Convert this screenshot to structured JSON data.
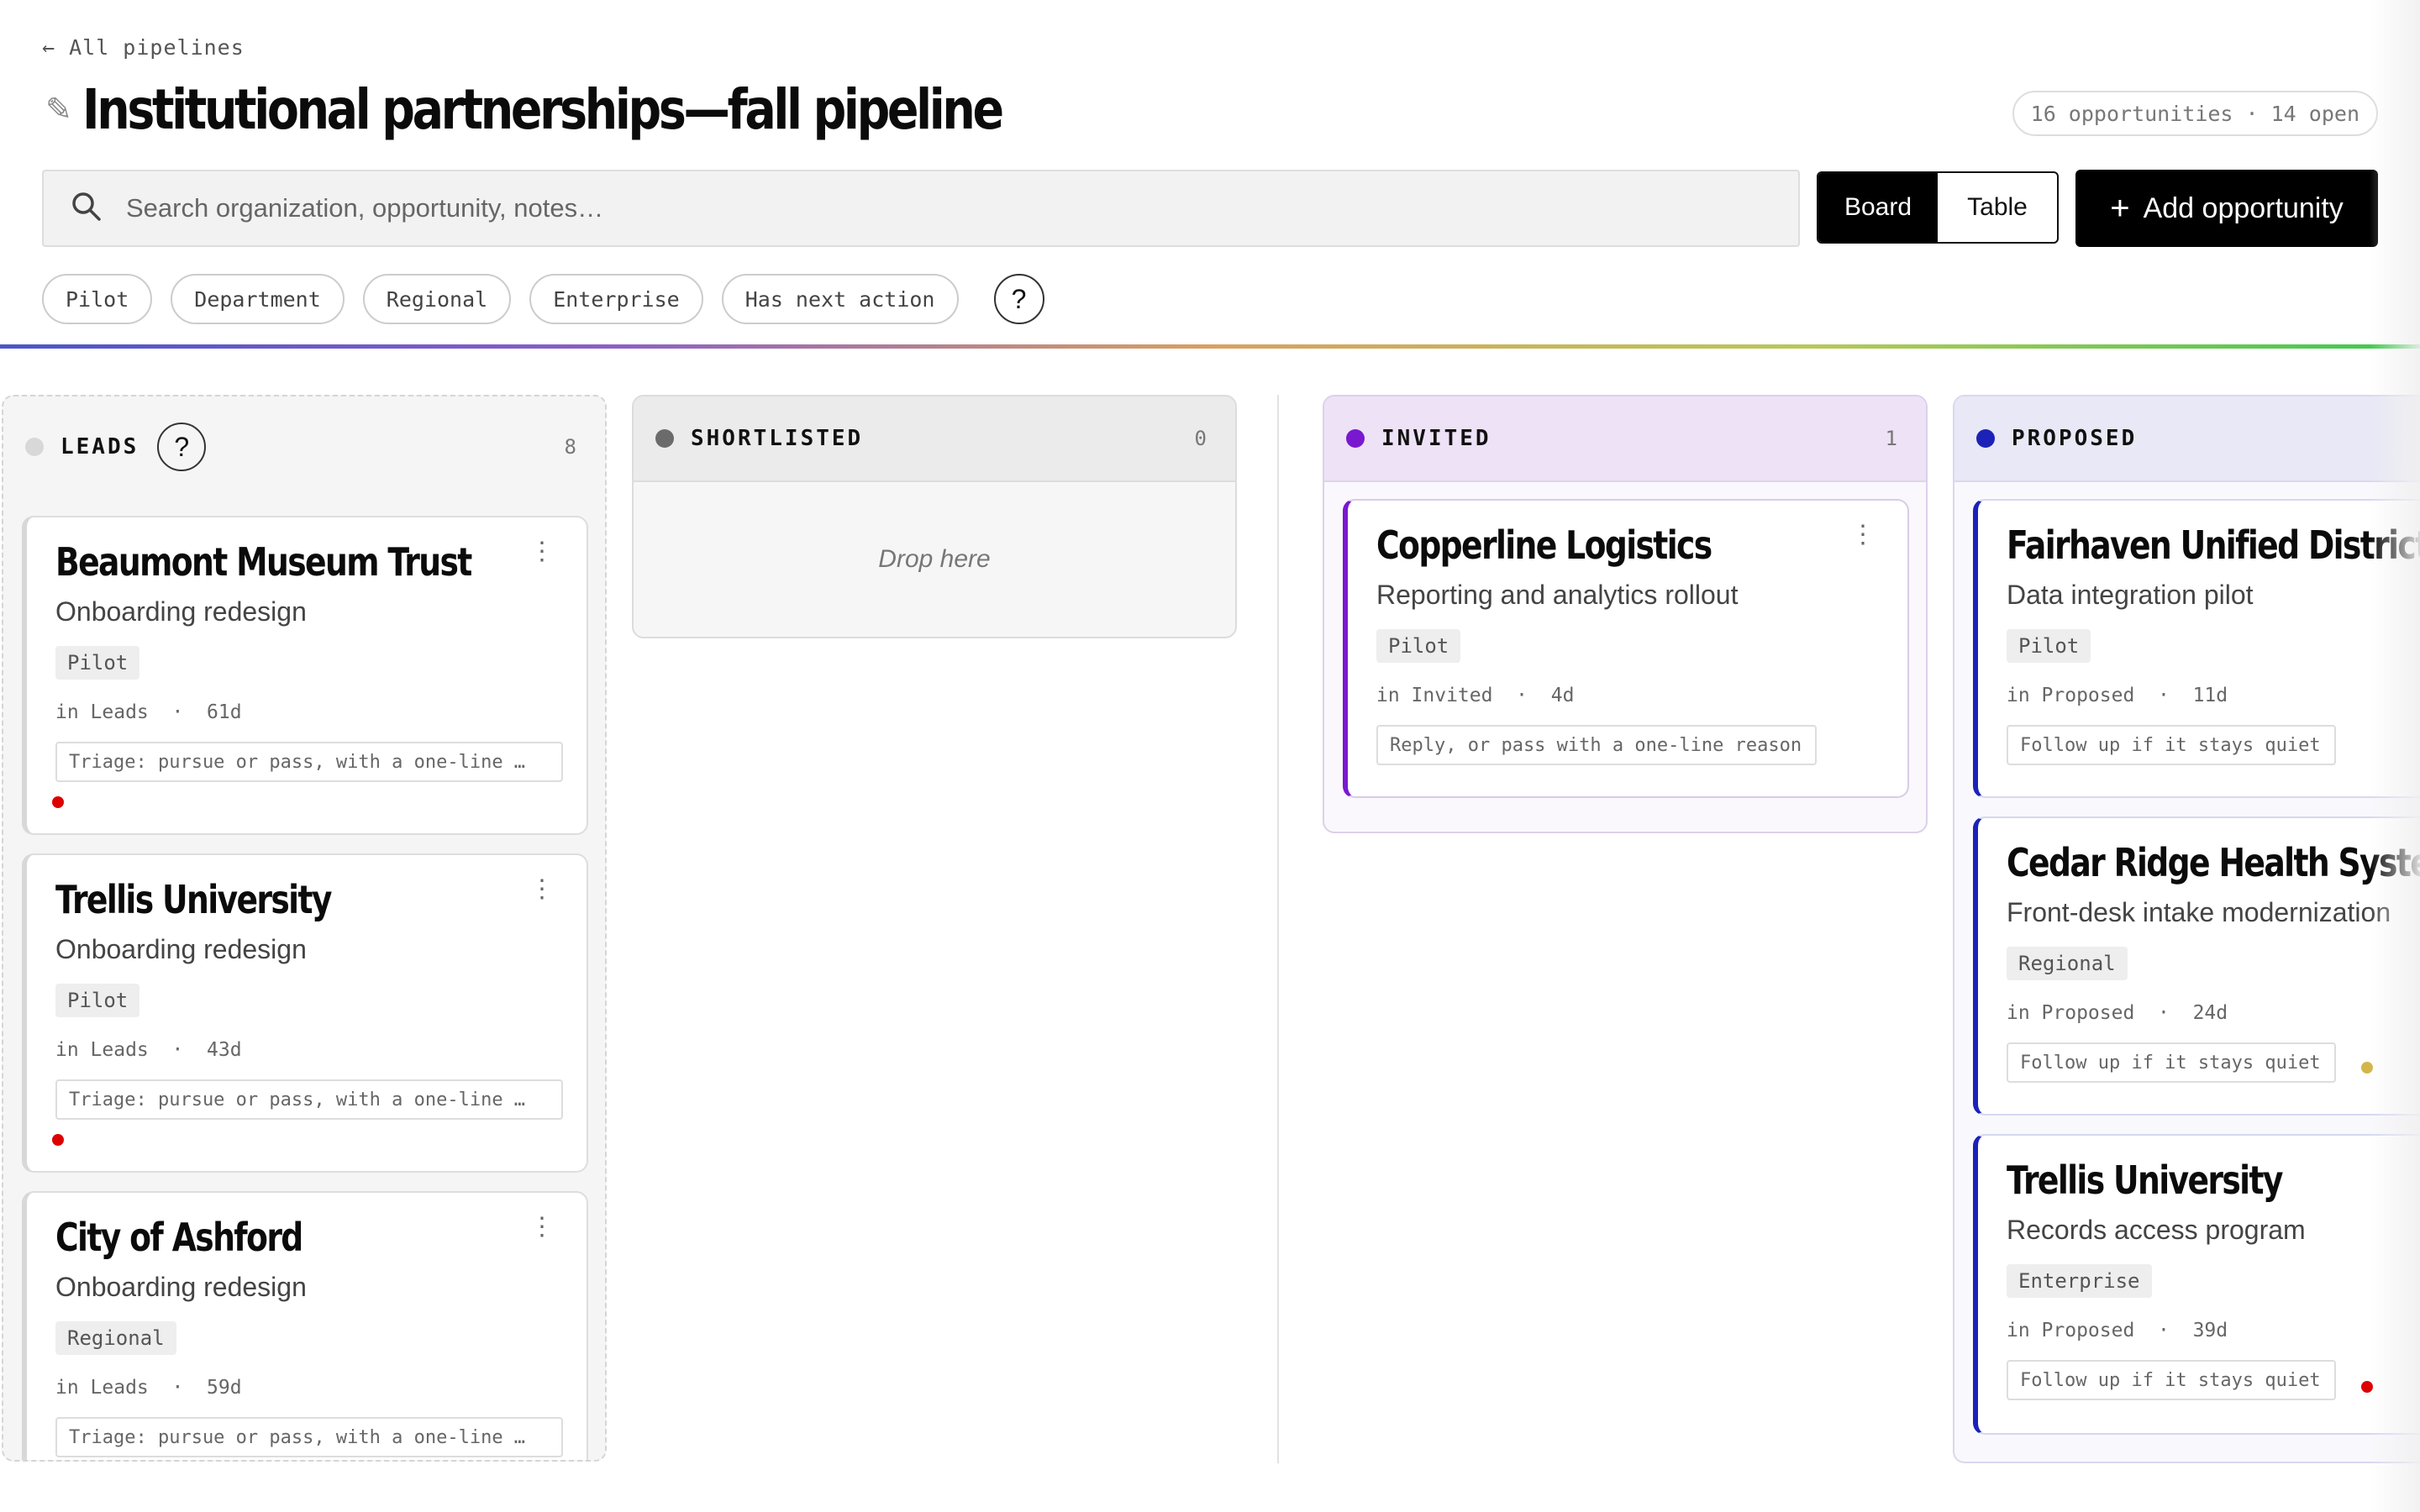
{
  "nav": {
    "back_label": "← All pipelines"
  },
  "header": {
    "title": "Institutional partnerships—fall pipeline",
    "count_badge": "16 opportunities · 14 open"
  },
  "search": {
    "placeholder": "Search organization, opportunity, notes…"
  },
  "view_toggle": {
    "board_label": "Board",
    "table_label": "Table",
    "active": "Board"
  },
  "add_button": {
    "plus": "+",
    "label": "Add opportunity"
  },
  "filters": [
    "Pilot",
    "Department",
    "Regional",
    "Enterprise",
    "Has next action"
  ],
  "help": "?",
  "colors": {
    "leads": "#d8d8d8",
    "shortlisted": "#6b6b6b",
    "invited": "#7a18d0",
    "proposed": "#1c22b8",
    "overdue": "#dd0000",
    "warning": "#d4b54a"
  },
  "columns": {
    "leads": {
      "name": "LEADS",
      "count": "8",
      "cards": [
        {
          "title": "Beaumont Museum Trust",
          "subtitle": "Onboarding redesign",
          "tag": "Pilot",
          "stage": "in Leads",
          "age": "61d",
          "next_action": "Triage: pursue or pass, with a one-line …",
          "flag": "overdue"
        },
        {
          "title": "Trellis University",
          "subtitle": "Onboarding redesign",
          "tag": "Pilot",
          "stage": "in Leads",
          "age": "43d",
          "next_action": "Triage: pursue or pass, with a one-line …",
          "flag": "overdue"
        },
        {
          "title": "City of Ashford",
          "subtitle": "Onboarding redesign",
          "tag": "Regional",
          "stage": "in Leads",
          "age": "59d",
          "next_action": "Triage: pursue or pass, with a one-line …"
        }
      ]
    },
    "shortlisted": {
      "name": "SHORTLISTED",
      "count": "0",
      "empty_label": "Drop here"
    },
    "invited": {
      "name": "INVITED",
      "count": "1",
      "cards": [
        {
          "title": "Copperline Logistics",
          "subtitle": "Reporting and analytics rollout",
          "tag": "Pilot",
          "stage": "in Invited",
          "age": "4d",
          "next_action": "Reply, or pass with a one-line reason"
        }
      ]
    },
    "proposed": {
      "name": "PROPOSED",
      "cards": [
        {
          "title": "Fairhaven Unified District",
          "subtitle": "Data integration pilot",
          "tag": "Pilot",
          "stage": "in Proposed",
          "age": "11d",
          "next_action": "Follow up if it stays quiet"
        },
        {
          "title": "Cedar Ridge Health System",
          "subtitle": "Front-desk intake modernization",
          "tag": "Regional",
          "stage": "in Proposed",
          "age": "24d",
          "next_action": "Follow up if it stays quiet",
          "flag": "warning"
        },
        {
          "title": "Trellis University",
          "subtitle": "Records access program",
          "tag": "Enterprise",
          "stage": "in Proposed",
          "age": "39d",
          "next_action": "Follow up if it stays quiet",
          "flag": "overdue"
        }
      ]
    }
  }
}
